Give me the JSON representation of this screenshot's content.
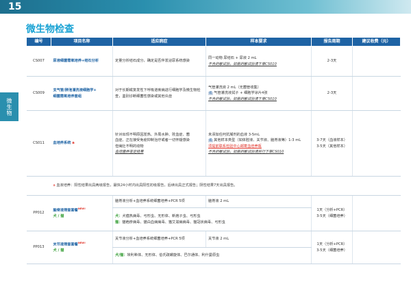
{
  "page": {
    "number": "15",
    "title": "微生物检查",
    "side_tab": "微生物"
  },
  "table": {
    "headers": [
      "编号",
      "项目名称",
      "适应病症",
      "样本要求",
      "报告周期",
      "建议收费（元）"
    ],
    "rows": [
      {
        "code": "CS007",
        "name": "尿液细菌需氧培养+结石分析",
        "indication": "定量分析结石成分，确定是否伴发泌尿系统感染",
        "sample_lines": [
          "同一动物 尿结石 + 尿液 2 mL"
        ],
        "sample_italic": "不含药敏试验，如需药敏试验请下单CS010",
        "period": "2-3天"
      },
      {
        "code": "CS009",
        "name_lines": [
          "支气管/肺泡灌洗液细胞学+",
          "细菌需氧培养套组"
        ],
        "indication": "对于长期或复发性下呼吸道疾病进行细胞学及微生物检查，鉴别诊断细菌性感染或其他炎症",
        "sample_lines": [
          "气管灌洗液 2 mL（无菌管收集）",
          "气管灌洗液拭子 + 细胞学涂片4张"
        ],
        "sample_mark": "或",
        "sample_italic": "不含药敏试验，如需药敏试验请下单CS010",
        "period": "2-3天"
      },
      {
        "code": "CS011",
        "name": "血培养系统",
        "name_sup": "a",
        "indication_lines": [
          "针对出现不明原因发热、外周水肿、败血症、菌",
          "血症、正在接受免疫抑制治疗或者一切怀疑感染",
          "但病灶不明的动物"
        ],
        "indication_italic": "血培菌养鉴定结果",
        "sample_lines": [
          "未添加任何抗凝剂的血液 3-5mL",
          "其他样本类型（如体腔液、关节液、脑脊液等）1-3 mL"
        ],
        "sample_mark": "或",
        "sample_red": "须提前联系检验中心邮寄血培养瓶",
        "sample_italic": "不含药敏试验，如需药敏试验请另行下单CS010",
        "period_lines": [
          "3-7天（血液样本）",
          "3-5天（其他样本）"
        ]
      }
    ],
    "footnote": {
      "symbol": "a",
      "text": "血液培养：阳性结果出具两级报告，最快24小时内出具阳性初级报告，后续出具正式报告；阴性结果7天出具报告。"
    },
    "panel_rows": [
      {
        "code": "PP012",
        "name": "脑脊液筛查套餐",
        "new": "NEW!",
        "species_parts": [
          "犬",
          "猫"
        ],
        "analysis": "脑脊液分析+血培养系统细菌培养+PCR 5项",
        "sample": "脑脊液 2 mL",
        "pathogen_dog_label": "犬：",
        "pathogen_dog": "犬瘟热病毒、弓形虫、无形体、新孢子虫、弓形虫",
        "pathogen_cat_label": "猫：",
        "pathogen_cat": "猫疱疹病毒、猫白血病病毒、猫艾滋病病毒、猫冠状病毒、弓形虫",
        "period_lines": [
          "1天（分析+PCR）",
          "3-5天（细菌培养）"
        ]
      },
      {
        "code": "PP013",
        "name": "关节液筛查套餐",
        "new": "NEW!",
        "species_parts": [
          "犬",
          "猫"
        ],
        "analysis": "关节液分析+血培养系统细菌培养+PCR 5项",
        "sample": "关节液 2 mL",
        "pathogen_label": "犬/猫：",
        "pathogen": "埃利希体、无形体、伯氏疏螺旋体、巴尔通体、利什曼原虫",
        "period_lines": [
          "1天（分析+PCR）",
          "3-5天（细菌培养）"
        ]
      }
    ]
  }
}
